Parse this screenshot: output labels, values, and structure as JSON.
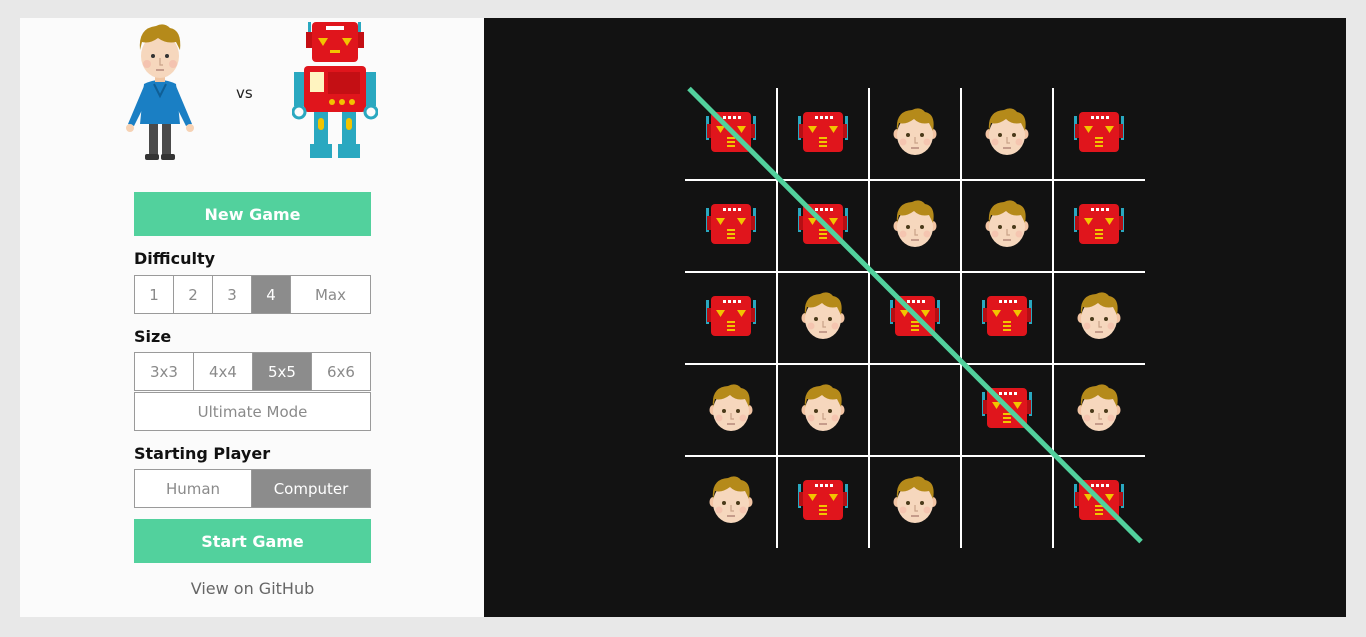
{
  "versus": {
    "label": "vs"
  },
  "controls": {
    "new_game": "New Game",
    "difficulty": {
      "label": "Difficulty",
      "options": [
        "1",
        "2",
        "3",
        "4",
        "Max"
      ],
      "selected": "4"
    },
    "size": {
      "label": "Size",
      "options": [
        "3x3",
        "4x4",
        "5x5",
        "6x6"
      ],
      "selected": "5x5"
    },
    "ultimate_mode": "Ultimate Mode",
    "starting_player": {
      "label": "Starting Player",
      "options": [
        "Human",
        "Computer"
      ],
      "selected": "Computer"
    },
    "start_game": "Start Game",
    "github_link": "View on GitHub"
  },
  "colors": {
    "accent": "#52d19d",
    "board_bg": "#121212",
    "robot": "#e0151c",
    "human_hair": "#b58a1a"
  },
  "board": {
    "size": 5,
    "cells": [
      [
        "robot",
        "robot",
        "human",
        "human",
        "robot"
      ],
      [
        "robot",
        "robot",
        "human",
        "human",
        "robot"
      ],
      [
        "robot",
        "human",
        "robot",
        "robot",
        "human"
      ],
      [
        "human",
        "human",
        "",
        "robot",
        "human"
      ],
      [
        "human",
        "robot",
        "human",
        "",
        "robot"
      ]
    ],
    "winning_line": "main-diagonal"
  }
}
